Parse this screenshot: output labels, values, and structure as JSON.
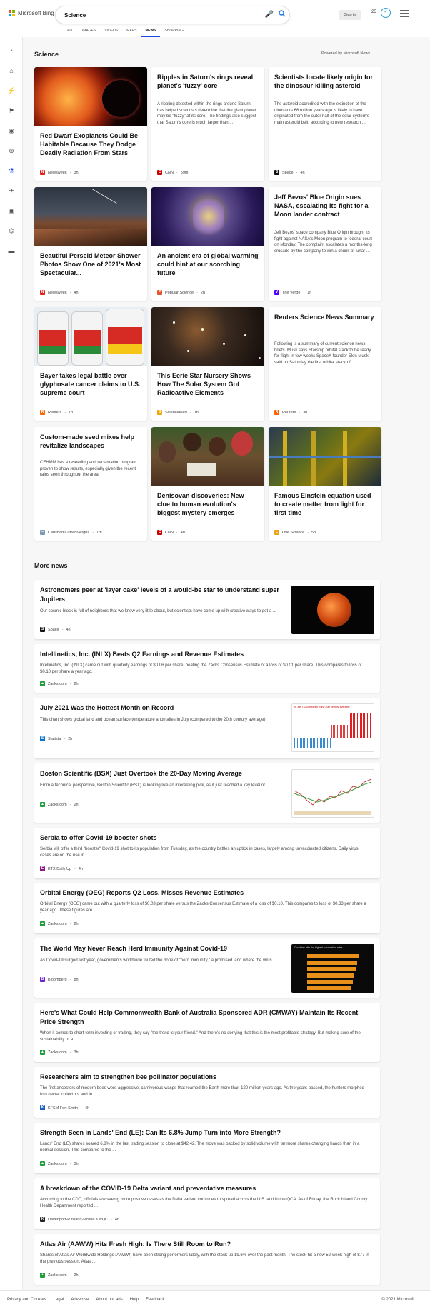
{
  "header": {
    "logo_text": "Microsoft Bing",
    "search_value": "Science",
    "sign_in": "Sign in",
    "rewards_points": "25",
    "tabs": [
      "ALL",
      "IMAGES",
      "VIDEOS",
      "MAPS",
      "NEWS",
      "SHOPPING"
    ],
    "active_tab": "NEWS"
  },
  "section": {
    "title": "Science",
    "powered_by": "Powered by Microsoft News"
  },
  "cards": [
    {
      "title": "Red Dwarf Exoplanets Could Be Habitable Because They Dodge Deadly Radiation From Stars",
      "desc": "",
      "source": "Newsweek",
      "time": "3h",
      "icon": "newsweek-icon",
      "color": "#e0201a"
    },
    {
      "title": "Ripples in Saturn's rings reveal planet's 'fuzzy' core",
      "desc": "A rippling detected within the rings around Saturn has helped scientists determine that the giant planet may be \"fuzzy\" at its core. The findings also suggest that Saturn's core is much larger than ...",
      "source": "CNN",
      "time": "59m",
      "icon": "cnn-icon",
      "color": "#cc0000"
    },
    {
      "title": "Scientists locate likely origin for the dinosaur-killing asteroid",
      "desc": "The asteroid accredited with the extinction of the dinosaurs 66 million years ago is likely to have originated from the outer half of the solar system's main asteroid belt, according to new research ...",
      "source": "Space",
      "time": "4h",
      "icon": "space-icon",
      "color": "#111111"
    },
    {
      "title": "Beautiful Perseid Meteor Shower Photos Show One of 2021's Most Spectacular...",
      "desc": "",
      "source": "Newsweek",
      "time": "4h",
      "icon": "newsweek-icon",
      "color": "#e0201a"
    },
    {
      "title": "An ancient era of global warming could hint at our scorching future",
      "desc": "",
      "source": "Popular Science",
      "time": "2h",
      "icon": "popular-science-icon",
      "color": "#e8552a"
    },
    {
      "title": "Jeff Bezos' Blue Origin sues NASA, escalating its fight for a Moon lander contract",
      "desc": "Jeff Bezos' space company Blue Origin brought its fight against NASA's Moon program to federal court on Monday. The complaint escalates a months-long crusade by the company to win a chunk of lunar ...",
      "source": "The Verge",
      "time": "1h",
      "icon": "verge-icon",
      "color": "#5200ff"
    },
    {
      "title": "Bayer takes legal battle over glyphosate cancer claims to U.S. supreme court",
      "desc": "",
      "source": "Reuters",
      "time": "1h",
      "icon": "reuters-icon",
      "color": "#fa6400"
    },
    {
      "title": "This Eerie Star Nursery Shows How The Solar System Got Radioactive Elements",
      "desc": "",
      "source": "ScienceAlert",
      "time": "1h",
      "icon": "sciencealert-icon",
      "color": "#f5a300"
    },
    {
      "title": "Reuters Science News Summary",
      "desc": "Following is a summary of current science news briefs. Musk says Starship orbital stack to be ready for flight in few weeks SpaceX founder Elon Musk said on Saturday the first orbital stack of ...",
      "source": "Reuters",
      "time": "3h",
      "icon": "reuters-icon",
      "color": "#fa6400"
    },
    {
      "title": "Custom-made seed mixes help revitalize landscapes",
      "desc": "CEHMM has a reseeding and reclamation program proven to show results, especially given the recent rains seen throughout the area.",
      "source": "Carlsbad Current-Argus",
      "time": "7m",
      "icon": "current-argus-icon",
      "color": "#7a9ab5"
    },
    {
      "title": "Denisovan discoveries: New clue to human evolution's biggest mystery emerges",
      "desc": "",
      "source": "CNN",
      "time": "4h",
      "icon": "cnn-icon",
      "color": "#cc0000"
    },
    {
      "title": "Famous Einstein equation used to create matter from light for first time",
      "desc": "",
      "source": "Live Science",
      "time": "5h",
      "icon": "live-science-icon",
      "color": "#e8a317"
    }
  ],
  "more_news": {
    "title": "More news",
    "items": [
      {
        "title": "Astronomers peer at 'layer cake' levels of a would-be star to understand super Jupiters",
        "desc": "Our cosmic block is full of neighbors that we know very little about, but scientists have come up with creative ways to get a ...",
        "source": "Space",
        "time": "4h",
        "icon": "space-icon",
        "color": "#111111"
      },
      {
        "title": "Intellinetics, Inc. (INLX) Beats Q2 Earnings and Revenue Estimates",
        "desc": "Intellinetics, Inc. (INLX) came out with quarterly earnings of $0.06 per share, beating the Zacks Consensus Estimate of a loss of $0.01 per share. This compares to loss of $0.10 per share a year ago.",
        "source": "Zacks.com",
        "time": "2h",
        "icon": "zacks-icon",
        "color": "#1e9e3a"
      },
      {
        "title": "July 2021 Was the Hottest Month on Record",
        "desc": "This chart shows global land and ocean surface temperature anomalies in July (compared to the 20th century average).",
        "source": "Statista",
        "time": "2h",
        "icon": "statista-icon",
        "color": "#0a73cc"
      },
      {
        "title": "Boston Scientific (BSX) Just Overtook the 20-Day Moving Average",
        "desc": "From a technical perspective, Boston Scientific (BSX) is looking like an interesting pick, as it just reached a key level of ...",
        "source": "Zacks.com",
        "time": "2h",
        "icon": "zacks-icon",
        "color": "#1e9e3a"
      },
      {
        "title": "Serbia to offer Covid-19 booster shots",
        "desc": "Serbia will offer a third \"booster\" Covid-19 shot to its population from Tuesday, as the country battles an uptick in cases, largely among unvaccinated citizens. Daily virus cases are on the rise in ...",
        "source": "ETX Daily Up",
        "time": "4h",
        "icon": "etx-icon",
        "color": "#8a1a8a"
      },
      {
        "title": "Orbital Energy (OEG) Reports Q2 Loss, Misses Revenue Estimates",
        "desc": "Orbital Energy (OEG) came out with a quarterly loss of $0.03 per share versus the Zacks Consensus Estimate of a loss of $0.10. This compares to loss of $0.33 per share a year ago. These figures are ...",
        "source": "Zacks.com",
        "time": "2h",
        "icon": "zacks-icon",
        "color": "#1e9e3a"
      },
      {
        "title": "The World May Never Reach Herd Immunity Against Covid-19",
        "desc": "As Covid-19 surged last year, governments worldwide touted the hope of \"herd immunity,\" a promised land where the virus ...",
        "source": "Bloomberg",
        "time": "8h",
        "icon": "bloomberg-icon",
        "color": "#6a1fd0"
      },
      {
        "title": "Here's What Could Help Commonwealth Bank of Australia Sponsored ADR (CMWAY) Maintain Its Recent Price Strength",
        "desc": "When it comes to short-term investing or trading, they say \"the trend is your friend.\" And there's no denying that this is the most profitable strategy. But making sure of the sustainability of a ...",
        "source": "Zacks.com",
        "time": "3h",
        "icon": "zacks-icon",
        "color": "#1e9e3a"
      },
      {
        "title": "Researchers aim to strengthen bee pollinator populations",
        "desc": "The first ancestors of modern bees were aggressive, carnivorous wasps that roamed the Earth more than 120 million years ago. As the years passed, the hunters morphed into nectar collectors and in ...",
        "source": "KFSM Fort Smith",
        "time": "4h",
        "icon": "kfsm-icon",
        "color": "#1f5fbf"
      },
      {
        "title": "Strength Seen in Lands' End (LE): Can Its 6.8% Jump Turn into More Strength?",
        "desc": "Lands' End (LE) shares soared 6.8% in the last trading session to close at $42.42. The move was backed by solid volume with far more shares changing hands than in a normal session. This compares to the ...",
        "source": "Zacks.com",
        "time": "3h",
        "icon": "zacks-icon",
        "color": "#1e9e3a"
      },
      {
        "title": "A breakdown of the COVID-19 Delta variant and preventative measures",
        "desc": "According to the CDC, officials are seeing more positive cases as the Delta variant continues to spread across the U.S. and in the QCA. As of Friday, the Rock Island County Health Department reported ...",
        "source": "Davenport-R Island-Moline KWQC",
        "time": "4h",
        "icon": "kwqc-icon",
        "color": "#222222"
      },
      {
        "title": "Atlas Air (AAWW) Hits Fresh High: Is There Still Room to Run?",
        "desc": "Shares of Atlas Air Worldwide Holdings (AAWW) have been strong performers lately, with the stock up 19.6% over the past month. The stock hit a new 52-week high of $77 in the previous session. Atlas ...",
        "source": "Zacks.com",
        "time": "2h",
        "icon": "zacks-icon",
        "color": "#1e9e3a"
      }
    ]
  },
  "thumb_text": {
    "statista_caption": "In July (°C compared to the 20th century average)",
    "herd_caption": "Countries with the highest vaccination rates"
  },
  "footer": {
    "links": [
      "Privacy and Cookies",
      "Legal",
      "Advertise",
      "About our ads",
      "Help",
      "Feedback"
    ],
    "copyright": "© 2021 Microsoft"
  }
}
